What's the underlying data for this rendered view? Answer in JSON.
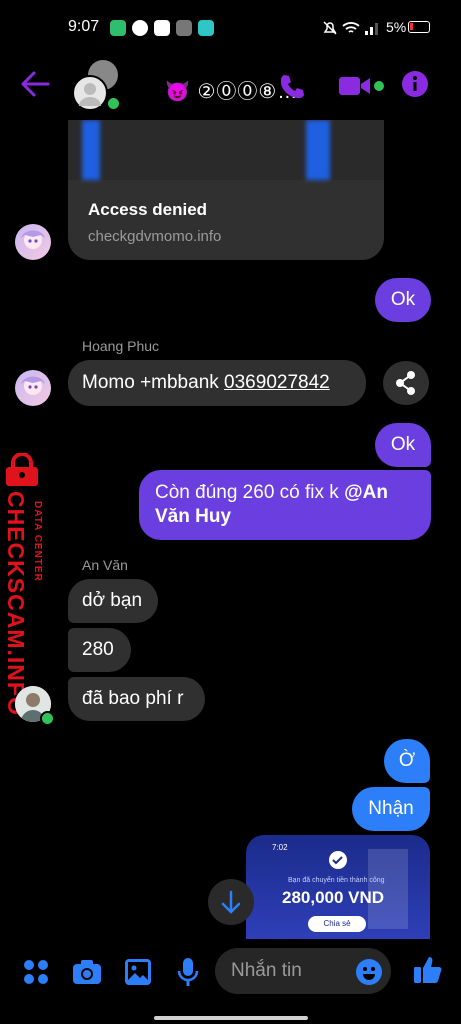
{
  "status_bar": {
    "time": "9:07",
    "battery": "5%"
  },
  "header": {
    "title": "😈 ②⓪⓪⑧…"
  },
  "link_preview": {
    "title": "Access denied",
    "domain": "checkgdvmomo.info"
  },
  "messages": {
    "m1": "Ok",
    "sender_1": "Hoang Phuc",
    "m2_prefix": "Momo +mbbank ",
    "m2_phone": "0369027842",
    "m3": "Ok",
    "m4_text": "Còn đúng 260 có fix k ",
    "m4_mention": "@An Văn Huy",
    "sender_2": "An Văn",
    "m5": "dở bạn",
    "m6": "280",
    "m7": "đã bao phí r",
    "m8": "Ờ",
    "m9": "Nhận"
  },
  "receipt": {
    "time": "7:02",
    "title": "Bạn đã chuyển tiền thành công",
    "amount": "280,000 VND",
    "share_label": "Chia sẻ"
  },
  "watermark": {
    "brand": "CHECKSCAM.INFO",
    "sub": "DATA CENTER"
  },
  "composer": {
    "placeholder": "Nhắn tin"
  },
  "colors": {
    "accent": "#8a2be2",
    "outgoing": "#6b3ee0",
    "incoming": "#303030",
    "blue": "#2d7ff9"
  }
}
